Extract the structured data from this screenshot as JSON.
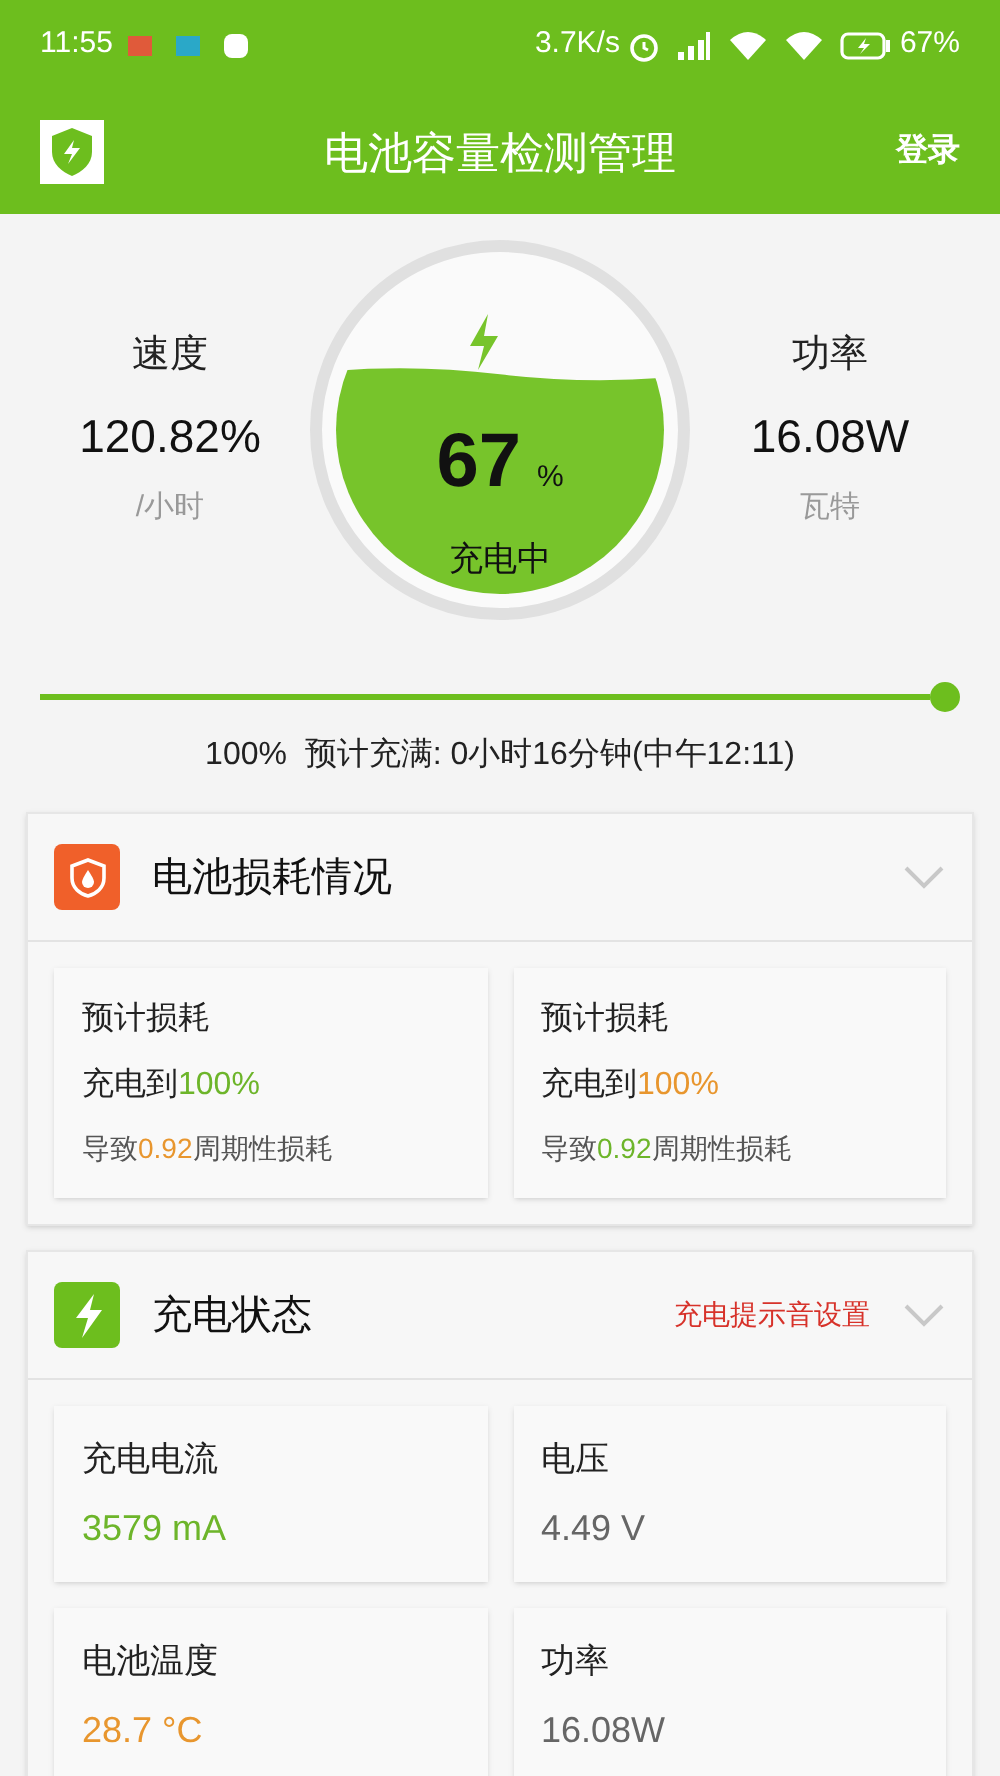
{
  "status_bar": {
    "time": "11:55",
    "speed": "3.7K/s",
    "battery": "67%"
  },
  "app_bar": {
    "title": "电池容量检测管理",
    "action": "登录"
  },
  "gauge": {
    "percent": "67",
    "unit": "%",
    "state": "充电中"
  },
  "stats": [
    {
      "label": "速度",
      "value": "120.82%",
      "unit": "/小时"
    },
    {
      "label": "功率",
      "value": "16.08W",
      "unit": "瓦特"
    }
  ],
  "progress": {
    "level": 1.0,
    "text": "100%  预计充满: 0小时16分钟(中午12:11)"
  },
  "loss_panel": {
    "title": "电池损耗情况",
    "cards": [
      {
        "title": "预计损耗",
        "prefix": "充电到",
        "target": {
          "text": "100%",
          "color": "#6db52a"
        },
        "note_prefix": "导致",
        "note_value": {
          "text": "0.92",
          "color": "#e8962e"
        },
        "note_suffix": "周期性损耗"
      },
      {
        "title": "预计损耗",
        "prefix": "充电到",
        "target": {
          "text": "100%",
          "color": "#e8962e"
        },
        "note_prefix": "导致",
        "note_value": {
          "text": "0.92",
          "color": "#6db52a"
        },
        "note_suffix": "周期性损耗"
      }
    ]
  },
  "charge_panel": {
    "title": "充电状态",
    "link": "充电提示音设置",
    "cards": [
      {
        "label": "充电电流",
        "value": "3579 mA",
        "color": "#6db52a"
      },
      {
        "label": "电压",
        "value": "4.49 V",
        "color": "#666666"
      },
      {
        "label": "电池温度",
        "value": "28.7 °C",
        "color": "#e8962e"
      },
      {
        "label": "功率",
        "value": "16.08W",
        "color": "#666666"
      }
    ]
  }
}
